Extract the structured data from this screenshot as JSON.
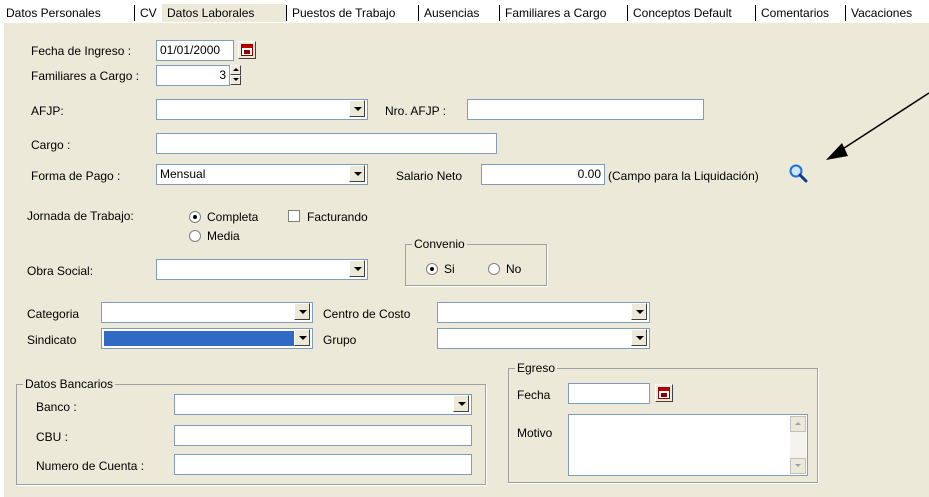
{
  "tabs": [
    {
      "label": "Datos Personales"
    },
    {
      "label": "CV"
    },
    {
      "label": "Datos Laborales"
    },
    {
      "label": "Puestos de Trabajo"
    },
    {
      "label": "Ausencias"
    },
    {
      "label": "Familiares a Cargo"
    },
    {
      "label": "Conceptos Default"
    },
    {
      "label": "Comentarios"
    },
    {
      "label": "Vacaciones"
    }
  ],
  "active_tab": "Datos Laborales",
  "form": {
    "fecha_ingreso": {
      "label": "Fecha de Ingreso :",
      "value": "01/01/2000"
    },
    "familiares": {
      "label": "Familiares a Cargo :",
      "value": "3"
    },
    "afjp": {
      "label": "AFJP:",
      "value": ""
    },
    "nro_afjp": {
      "label": "Nro. AFJP :",
      "value": ""
    },
    "cargo": {
      "label": "Cargo :",
      "value": ""
    },
    "forma_pago": {
      "label": "Forma de Pago :",
      "value": "Mensual"
    },
    "salario_neto": {
      "label": "Salario Neto",
      "value": "0.00",
      "note": "(Campo para la Liquidación)"
    },
    "jornada": {
      "label": "Jornada de Trabajo:",
      "options": [
        "Completa",
        "Media"
      ],
      "selected": "Completa"
    },
    "facturando": {
      "label": "Facturando",
      "checked": false
    },
    "convenio": {
      "label": "Convenio",
      "options": [
        "Si",
        "No"
      ],
      "selected": "Si"
    },
    "obra_social": {
      "label": "Obra Social:",
      "value": ""
    },
    "categoria": {
      "label": "Categoria",
      "value": ""
    },
    "centro_costo": {
      "label": "Centro de Costo",
      "value": ""
    },
    "sindicato": {
      "label": "Sindicato",
      "value": ""
    },
    "grupo": {
      "label": "Grupo",
      "value": ""
    },
    "datos_bancarios": {
      "title": "Datos Bancarios",
      "banco": {
        "label": "Banco :",
        "value": ""
      },
      "cbu": {
        "label": "CBU :",
        "value": ""
      },
      "numero_cuenta": {
        "label": "Numero de Cuenta :",
        "value": ""
      }
    },
    "egreso": {
      "title": "Egreso",
      "fecha": {
        "label": "Fecha",
        "value": ""
      },
      "motivo": {
        "label": "Motivo",
        "value": ""
      }
    }
  },
  "colors": {
    "panel": "#ece9d8",
    "field_border": "#7f9db9",
    "selected_fill": "#316ac5",
    "search_icon": "#1e6fd9"
  }
}
